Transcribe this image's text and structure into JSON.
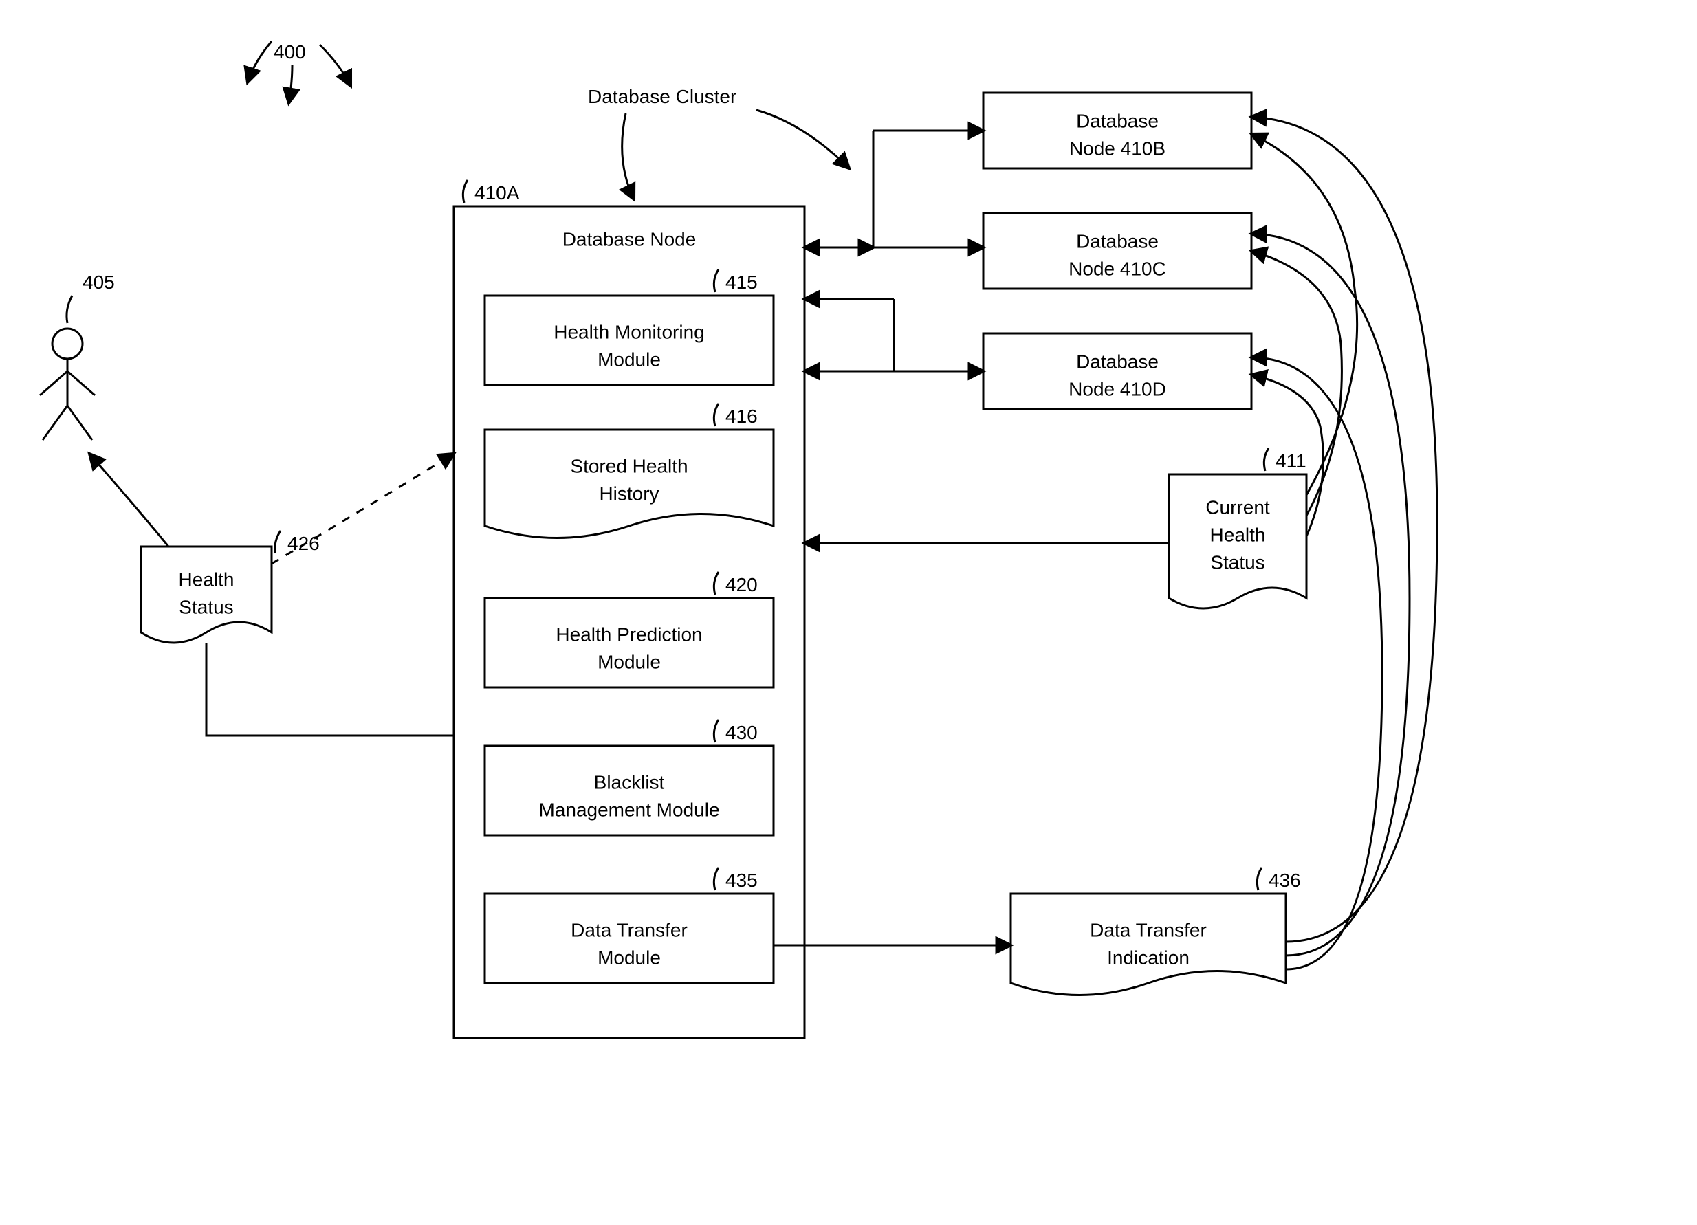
{
  "refs": {
    "system": "400",
    "user": "405",
    "nodeA": "410A",
    "nodeB": "Database Node 410B",
    "nodeC": "Database Node 410C",
    "nodeD": "Database Node 410D",
    "currentHealthRef": "411",
    "healthMonRef": "415",
    "storedHistRef": "416",
    "healthPredRef": "420",
    "healthStatusRef": "426",
    "blacklistRef": "430",
    "dataTransferRef": "435",
    "dataTransferIndRef": "436"
  },
  "labels": {
    "databaseCluster": "Database Cluster",
    "databaseNodeTitle": "Database Node",
    "healthMonitoring1": "Health Monitoring",
    "healthMonitoring2": "Module",
    "storedHealth1": "Stored Health",
    "storedHealth2": "History",
    "healthPrediction1": "Health Prediction",
    "healthPrediction2": "Module",
    "blacklist1": "Blacklist",
    "blacklist2": "Management Module",
    "dataTransfer1": "Data Transfer",
    "dataTransfer2": "Module",
    "healthStatus1": "Health",
    "healthStatus2": "Status",
    "currentHealth1": "Current",
    "currentHealth2": "Health",
    "currentHealth3": "Status",
    "dataTransferInd1": "Data Transfer",
    "dataTransferInd2": "Indication",
    "nodeB1": "Database",
    "nodeB2": "Node 410B",
    "nodeC1": "Database",
    "nodeC2": "Node 410C",
    "nodeD1": "Database",
    "nodeD2": "Node 410D"
  }
}
